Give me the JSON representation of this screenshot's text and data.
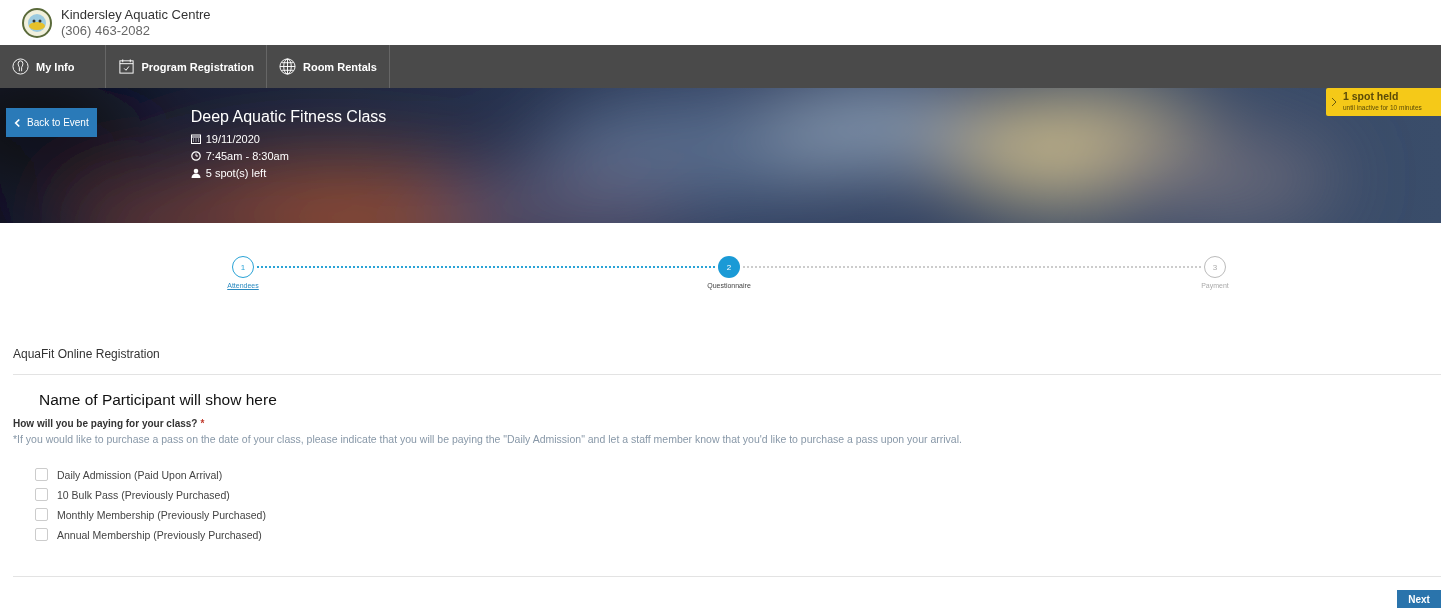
{
  "header": {
    "name": "Kindersley Aquatic Centre",
    "phone": "(306) 463-2082"
  },
  "nav": [
    {
      "label": "My Info"
    },
    {
      "label": "Program Registration"
    },
    {
      "label": "Room Rentals"
    }
  ],
  "event": {
    "back": "Back to Event",
    "title": "Deep Aquatic Fitness Class",
    "date": "19/11/2020",
    "time": "7:45am - 8:30am",
    "spots": "5 spot(s) left"
  },
  "hold": {
    "title": "1 spot held",
    "subtitle": "until inactive for 10 minutes"
  },
  "steps": [
    {
      "number": "1",
      "label": "Attendees",
      "completed": true,
      "selected": false
    },
    {
      "number": "2",
      "label": "Questionnaire",
      "completed": false,
      "selected": true
    },
    {
      "number": "3",
      "label": "Payment",
      "completed": false,
      "selected": false
    }
  ],
  "form": {
    "title": "AquaFit Online Registration",
    "participant": "Name of Participant will show here",
    "question": "How will you be paying for your class?",
    "required": "*",
    "note": "*If you would like to purchase a pass on the date of your class, please indicate that you will be paying the \"Daily Admission\" and let a staff member know that you'd like to purchase a pass upon your arrival.",
    "options": [
      {
        "label": "Daily Admission (Paid Upon Arrival)",
        "checked": false
      },
      {
        "label": "10 Bulk Pass (Previously Purchased)",
        "checked": false
      },
      {
        "label": "Monthly Membership (Previously Purchased)",
        "checked": false
      },
      {
        "label": "Annual Membership (Previously Purchased)",
        "checked": false
      }
    ]
  },
  "next": "Next"
}
